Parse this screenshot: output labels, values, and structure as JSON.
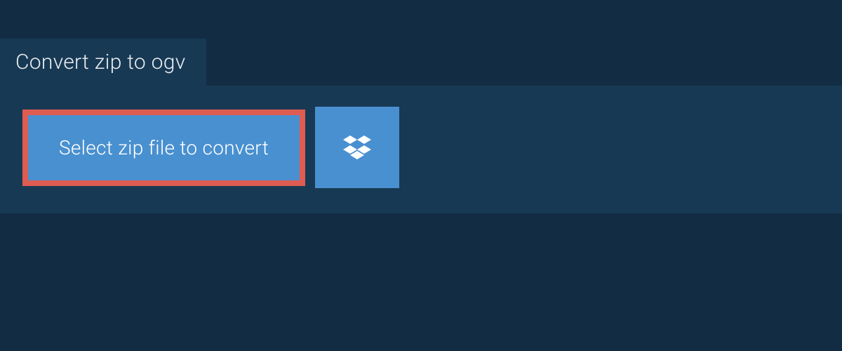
{
  "tab": {
    "label": "Convert zip to ogv"
  },
  "actions": {
    "select_label": "Select zip file to convert"
  },
  "colors": {
    "page_bg": "#122c44",
    "panel_bg": "#183954",
    "button_bg": "#4990d0",
    "highlight_border": "#de5c52",
    "text_light": "#ffffff"
  },
  "icons": {
    "dropbox": "dropbox-icon"
  }
}
